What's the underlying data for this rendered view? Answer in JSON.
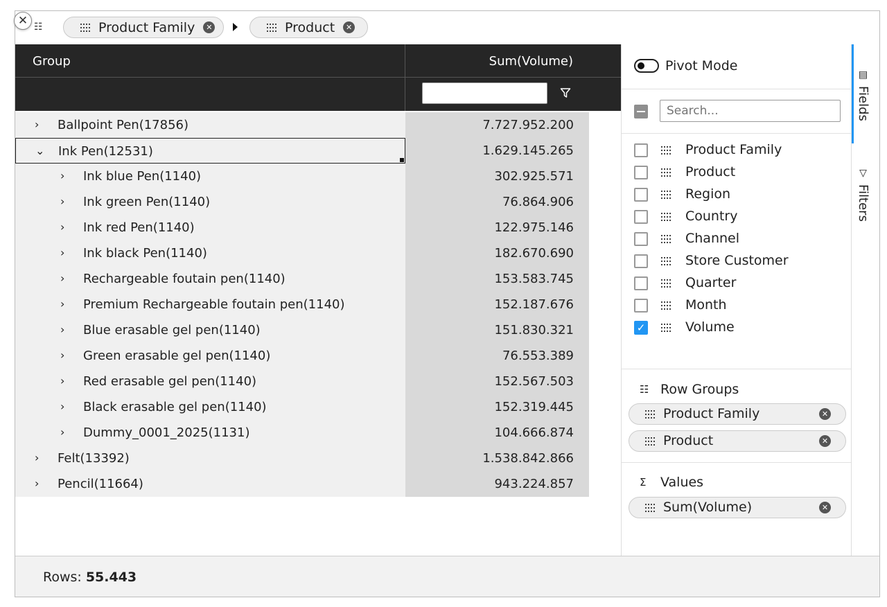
{
  "toolbar": {
    "chips": [
      "Product Family",
      "Product"
    ]
  },
  "grid": {
    "columns": {
      "group": "Group",
      "value": "Sum(Volume)"
    },
    "rows": [
      {
        "label": "Ballpoint Pen",
        "count": "(17856)",
        "value": "7.727.952.200",
        "level": 0,
        "expanded": false
      },
      {
        "label": "Ink Pen",
        "count": "(12531)",
        "value": "1.629.145.265",
        "level": 0,
        "expanded": true,
        "selected": true
      },
      {
        "label": "Ink blue Pen",
        "count": "(1140)",
        "value": "302.925.571",
        "level": 1,
        "expanded": false
      },
      {
        "label": "Ink green Pen",
        "count": "(1140)",
        "value": "76.864.906",
        "level": 1,
        "expanded": false
      },
      {
        "label": "Ink red Pen",
        "count": "(1140)",
        "value": "122.975.146",
        "level": 1,
        "expanded": false
      },
      {
        "label": "Ink black Pen",
        "count": "(1140)",
        "value": "182.670.690",
        "level": 1,
        "expanded": false
      },
      {
        "label": "Rechargeable foutain pen",
        "count": "(1140)",
        "value": "153.583.745",
        "level": 1,
        "expanded": false
      },
      {
        "label": "Premium Rechargeable foutain pen",
        "count": "(1140)",
        "value": "152.187.676",
        "level": 1,
        "expanded": false
      },
      {
        "label": "Blue erasable gel pen",
        "count": "(1140)",
        "value": "151.830.321",
        "level": 1,
        "expanded": false
      },
      {
        "label": "Green erasable gel pen",
        "count": "(1140)",
        "value": "76.553.389",
        "level": 1,
        "expanded": false
      },
      {
        "label": "Red erasable gel pen",
        "count": "(1140)",
        "value": "152.567.503",
        "level": 1,
        "expanded": false
      },
      {
        "label": "Black erasable gel pen",
        "count": "(1140)",
        "value": "152.319.445",
        "level": 1,
        "expanded": false
      },
      {
        "label": "Dummy_0001_2025",
        "count": "(1131)",
        "value": "104.666.874",
        "level": 1,
        "expanded": false
      },
      {
        "label": "Felt",
        "count": "(13392)",
        "value": "1.538.842.866",
        "level": 0,
        "expanded": false
      },
      {
        "label": "Pencil",
        "count": "(11664)",
        "value": "943.224.857",
        "level": 0,
        "expanded": false
      }
    ]
  },
  "panel": {
    "pivot_mode": "Pivot Mode",
    "search_placeholder": "Search...",
    "fields": [
      {
        "label": "Product Family",
        "checked": false
      },
      {
        "label": "Product",
        "checked": false
      },
      {
        "label": "Region",
        "checked": false
      },
      {
        "label": "Country",
        "checked": false
      },
      {
        "label": "Channel",
        "checked": false
      },
      {
        "label": "Store Customer",
        "checked": false
      },
      {
        "label": "Quarter",
        "checked": false
      },
      {
        "label": "Month",
        "checked": false
      },
      {
        "label": "Volume",
        "checked": true
      }
    ],
    "row_groups_title": "Row Groups",
    "row_groups": [
      "Product Family",
      "Product"
    ],
    "values_title": "Values",
    "values_icon": "Σ",
    "values": [
      "Sum(Volume)"
    ]
  },
  "tabs": {
    "fields": "Fields",
    "filters": "Filters"
  },
  "status": {
    "rows_label": "Rows:",
    "rows_value": "55.443"
  },
  "colors": {
    "header_bg": "#262626",
    "accent": "#2196f3",
    "value_col_bg": "#d9d9d9",
    "group_col_bg": "#f0f0f0"
  }
}
